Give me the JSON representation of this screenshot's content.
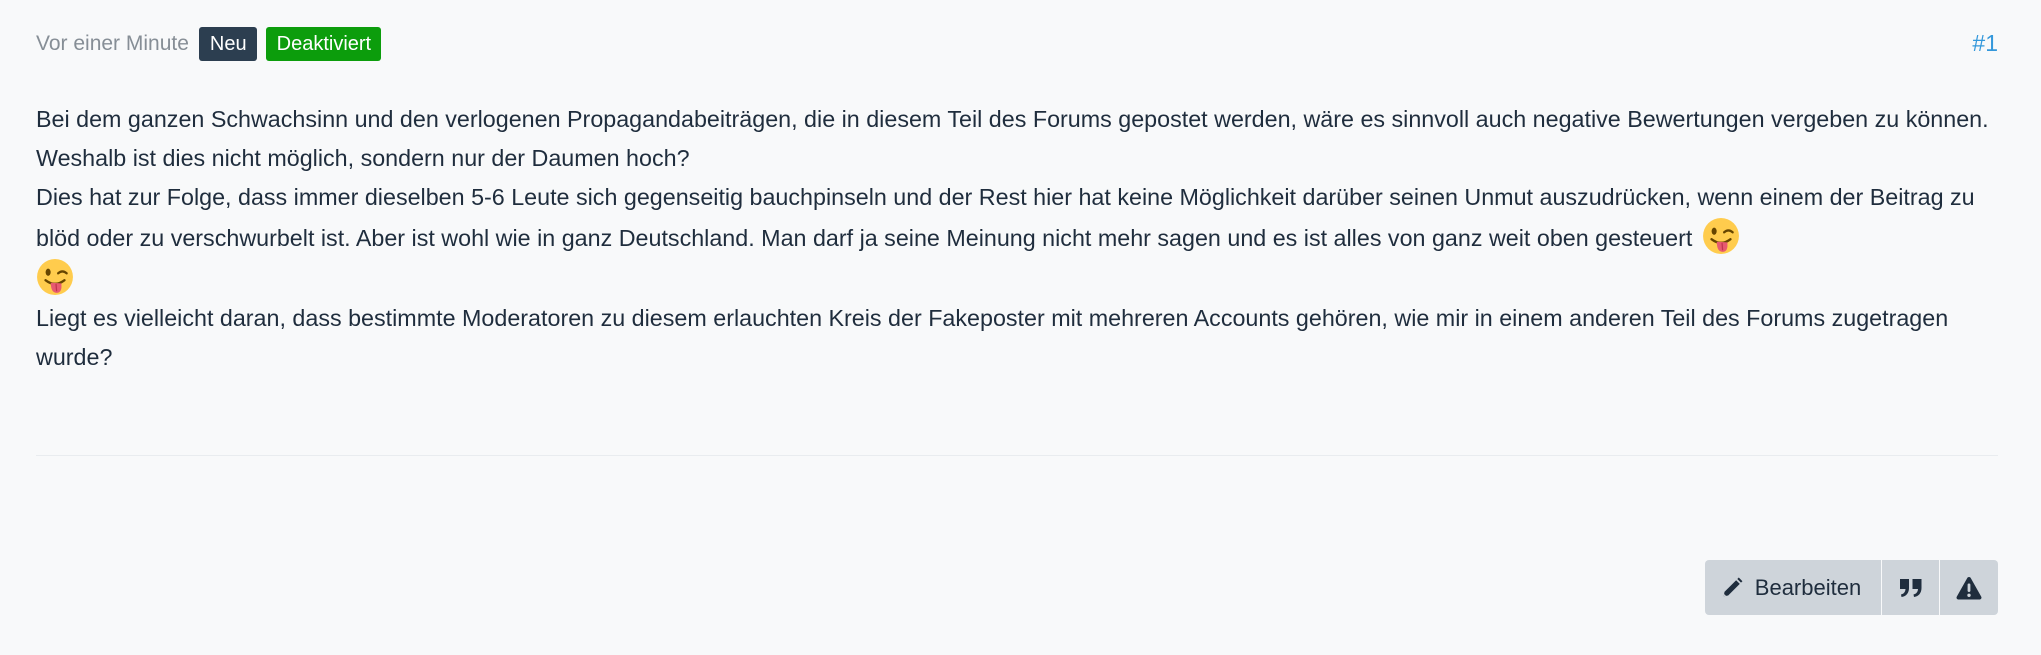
{
  "post": {
    "time": "Vor einer Minute",
    "badges": {
      "new": "Neu",
      "disabled": "Deaktiviert"
    },
    "number": "#1",
    "paragraphs": [
      "Bei dem ganzen Schwachsinn und den verlogenen Propagandabeiträgen, die in diesem Teil des Forums gepostet werden, wäre es sinnvoll auch negative Bewertungen vergeben zu können. Weshalb ist dies nicht möglich, sondern nur der Daumen hoch?",
      "Dies hat zur Folge, dass immer dieselben 5-6 Leute sich gegenseitig bauchpinseln und der Rest hier hat keine Möglichkeit darüber seinen Unmut auszudrücken, wenn einem der Beitrag zu blöd oder zu verschwurbelt ist. Aber ist wohl wie in ganz Deutschland. Man darf ja seine Meinung nicht mehr sagen und es ist alles von ganz weit oben gesteuert",
      "Liegt es vielleicht daran, dass bestimmte Moderatoren zu diesem erlauchten Kreis der Fakeposter mit mehreren Accounts gehören, wie mir in einem anderen Teil des Forums zugetragen wurde?"
    ],
    "emojis": [
      "winking-face-with-tongue",
      "winking-face-with-tongue"
    ]
  },
  "actions": {
    "edit_label": "Bearbeiten",
    "edit_icon": "pencil-icon",
    "quote_icon": "quote-icon",
    "report_icon": "warning-triangle-icon"
  },
  "colors": {
    "badge_new": "#2c3e50",
    "badge_disabled": "#0c9d0c",
    "post_number": "#3498db",
    "button_bg": "#ced4da",
    "page_bg": "#f8f9fa"
  }
}
